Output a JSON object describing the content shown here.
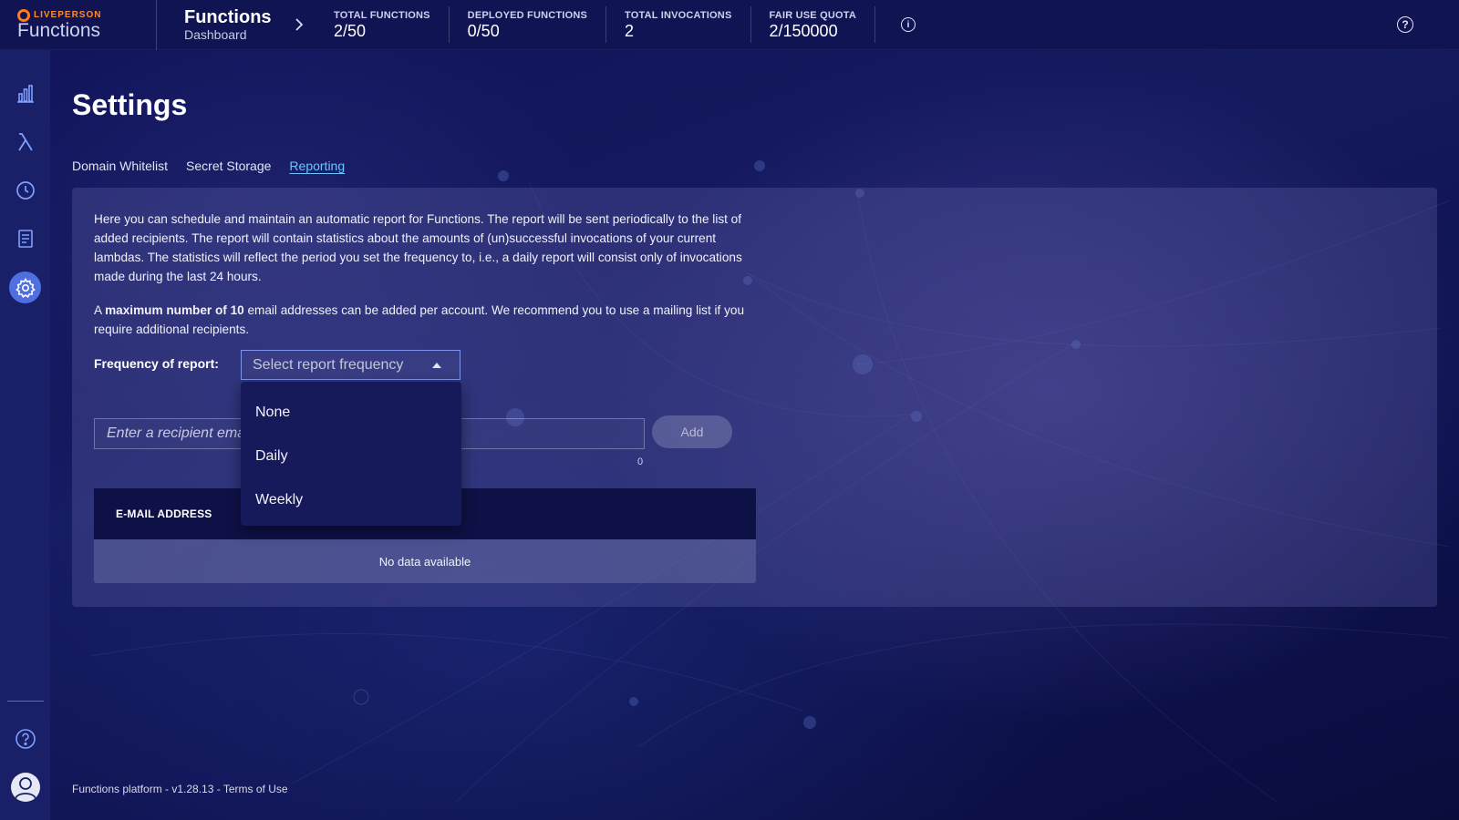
{
  "brand": {
    "company": "LIVEPERSON",
    "product": "Functions"
  },
  "breadcrumb": {
    "title": "Functions",
    "subtitle": "Dashboard"
  },
  "stats": [
    {
      "label": "TOTAL FUNCTIONS",
      "value": "2/50"
    },
    {
      "label": "DEPLOYED FUNCTIONS",
      "value": "0/50"
    },
    {
      "label": "TOTAL INVOCATIONS",
      "value": "2"
    },
    {
      "label": "FAIR USE QUOTA",
      "value": "2/150000"
    }
  ],
  "page": {
    "title": "Settings"
  },
  "tabs": [
    {
      "label": "Domain Whitelist",
      "active": false
    },
    {
      "label": "Secret Storage",
      "active": false
    },
    {
      "label": "Reporting",
      "active": true
    }
  ],
  "reporting": {
    "description": "Here you can schedule and maintain an automatic report for Functions. The report will be sent periodically to the list of added recipients. The report will contain statistics about the amounts of (un)successful invocations of your current lambdas. The statistics will reflect the period you set the frequency to, i.e., a daily report will consist only of invocations made during the last 24 hours.",
    "limit_prefix": "A ",
    "limit_bold": "maximum number of 10",
    "limit_suffix": " email addresses can be added per account. We recommend you to use a mailing list if you require additional recipients.",
    "frequency_label": "Frequency of report:",
    "frequency_placeholder": "Select report frequency",
    "frequency_options": [
      "None",
      "Daily",
      "Weekly"
    ],
    "email_placeholder": "Enter a recipient email",
    "email_counter": "0",
    "add_label": "Add",
    "table_header": "E-MAIL ADDRESS",
    "table_empty": "No data available"
  },
  "footer": {
    "text": "Functions platform - v1.28.13 - Terms of Use"
  },
  "colors": {
    "accent": "#4f6fe0",
    "link": "#6cc3ff",
    "brand_orange": "#ff7a1a"
  }
}
